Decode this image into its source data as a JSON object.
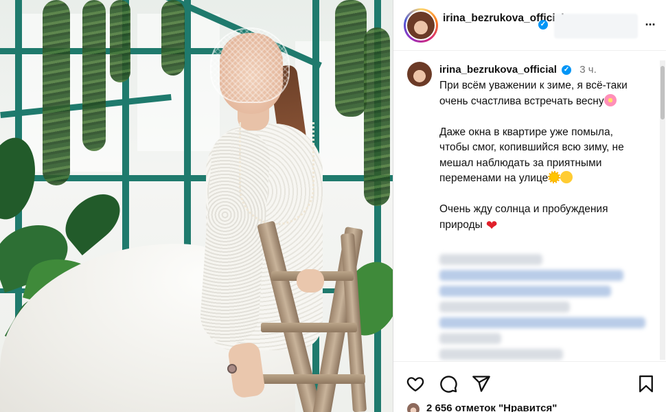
{
  "header": {
    "username": "irina_bezrukova_official",
    "more_icon": "more-horizontal-icon"
  },
  "caption": {
    "username": "irina_bezrukova_official",
    "time": "3 ч.",
    "paragraph1": "При всём уважении к зиме, я всё-таки очень счастлива встречать весну",
    "paragraph2": "Даже окна в квартире уже помыла, чтобы смог, копившийся всю зиму, не мешал наблюдать за приятными переменами на улице",
    "paragraph3": "Очень жду солнца и пробуждения природы",
    "emoji_flower": "flower-emoji",
    "emoji_sun": "sun-emoji",
    "emoji_smile": "smiling-face-emoji",
    "emoji_heart": "red-heart-emoji"
  },
  "actions": {
    "like_icon": "heart-icon",
    "comment_icon": "comment-icon",
    "share_icon": "send-icon",
    "save_icon": "bookmark-icon",
    "likes_count": "2 656 отметок \"Нравится\""
  },
  "colors": {
    "verified": "#0095f6",
    "text": "#111111",
    "muted": "#737373",
    "heart": "#e0202a"
  }
}
